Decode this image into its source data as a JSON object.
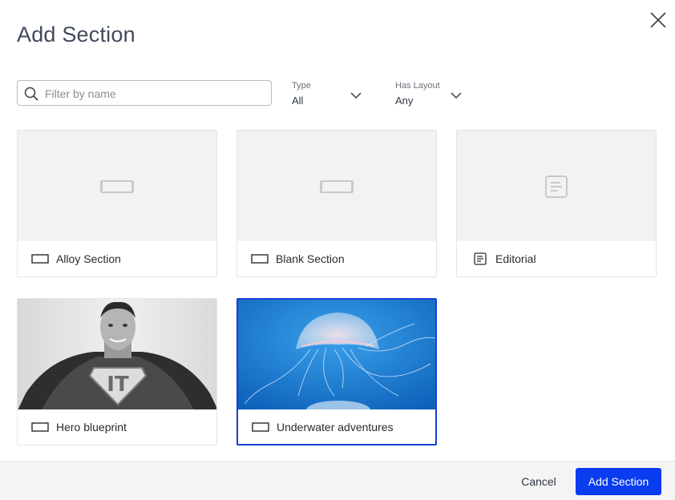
{
  "dialog": {
    "title": "Add Section",
    "close_icon": "close-icon"
  },
  "filters": {
    "search": {
      "placeholder": "Filter by name",
      "value": "",
      "icon": "search-icon"
    },
    "type": {
      "label": "Type",
      "value": "All",
      "icon": "chevron-down-icon"
    },
    "has_layout": {
      "label": "Has Layout",
      "value": "Any",
      "icon": "chevron-down-icon"
    }
  },
  "cards": [
    {
      "name": "Alloy Section",
      "icon": "section-icon",
      "thumbnail": "placeholder-section-icon",
      "selected": false
    },
    {
      "name": "Blank Section",
      "icon": "section-icon",
      "thumbnail": "placeholder-section-icon",
      "selected": false
    },
    {
      "name": "Editorial",
      "icon": "document-icon",
      "thumbnail": "placeholder-document-icon",
      "selected": false
    },
    {
      "name": "Hero blueprint",
      "icon": "section-icon",
      "thumbnail": "superhero-photo",
      "selected": false
    },
    {
      "name": "Underwater adventures",
      "icon": "section-icon",
      "thumbnail": "jellyfish-photo",
      "selected": true
    }
  ],
  "footer": {
    "cancel_label": "Cancel",
    "add_label": "Add Section"
  },
  "colors": {
    "primary": "#0a3cf0",
    "selected_border": "#1a3fd8",
    "title": "#3f4b5c"
  }
}
